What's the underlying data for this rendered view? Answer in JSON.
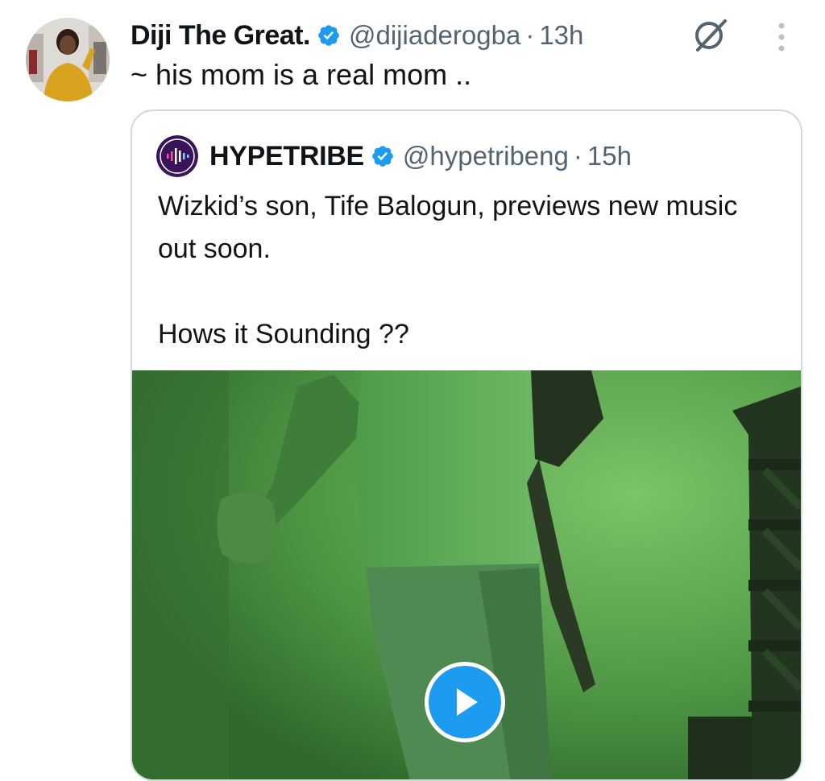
{
  "tweet": {
    "display_name": "Diji The Great.",
    "handle": "@dijiaderogba",
    "separator": "·",
    "time": "13h",
    "text": "~ his mom is a real mom .."
  },
  "quoted_tweet": {
    "display_name": "HYPETRIBE",
    "handle": "@hypetribeng",
    "separator": "·",
    "time": "15h",
    "text_line1": "Wizkid’s son, Tife Balogun, previews new music out soon.",
    "text_line2": "Hows it Sounding ??",
    "media_type": "video"
  },
  "icons": {
    "verified": "verified-badge-icon",
    "grok": "grok-icon",
    "more": "more-vertical-icon",
    "play": "play-icon"
  },
  "colors": {
    "accent": "#1d9bf0",
    "text_primary": "#0f1419",
    "text_secondary": "#536471",
    "border": "#cfd9de"
  }
}
